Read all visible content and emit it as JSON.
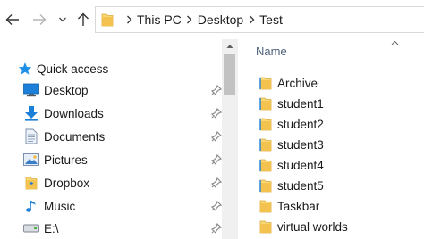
{
  "navigation": {
    "back_tooltip": "",
    "breadcrumb": [
      "This PC",
      "Desktop",
      "Test"
    ]
  },
  "nav_pane": {
    "quick_access_label": "Quick access",
    "items": [
      {
        "label": "Desktop",
        "icon": "desktop-icon",
        "pinned": true
      },
      {
        "label": "Downloads",
        "icon": "downloads-icon",
        "pinned": true
      },
      {
        "label": "Documents",
        "icon": "documents-icon",
        "pinned": true
      },
      {
        "label": "Pictures",
        "icon": "pictures-icon",
        "pinned": true
      },
      {
        "label": "Dropbox",
        "icon": "dropbox-icon",
        "pinned": true
      },
      {
        "label": "Music",
        "icon": "music-icon",
        "pinned": true
      },
      {
        "label": "E:\\",
        "icon": "drive-icon",
        "pinned": true
      }
    ]
  },
  "content": {
    "column_header": "Name",
    "files": [
      {
        "name": "Archive",
        "icon": "folder-icon"
      },
      {
        "name": "student1",
        "icon": "folder-icon"
      },
      {
        "name": "student2",
        "icon": "folder-icon"
      },
      {
        "name": "student3",
        "icon": "folder-icon"
      },
      {
        "name": "student4",
        "icon": "folder-icon"
      },
      {
        "name": "student5",
        "icon": "folder-icon"
      },
      {
        "name": "Taskbar",
        "icon": "folder-icon"
      },
      {
        "name": "virtual worlds",
        "icon": "folder-icon"
      }
    ]
  },
  "colors": {
    "accent_blue": "#0078d7",
    "folder_yellow": "#f8d775",
    "folder_dark": "#dcab3b",
    "header_text": "#4c607a",
    "pin_gray": "#8a8a8a"
  }
}
